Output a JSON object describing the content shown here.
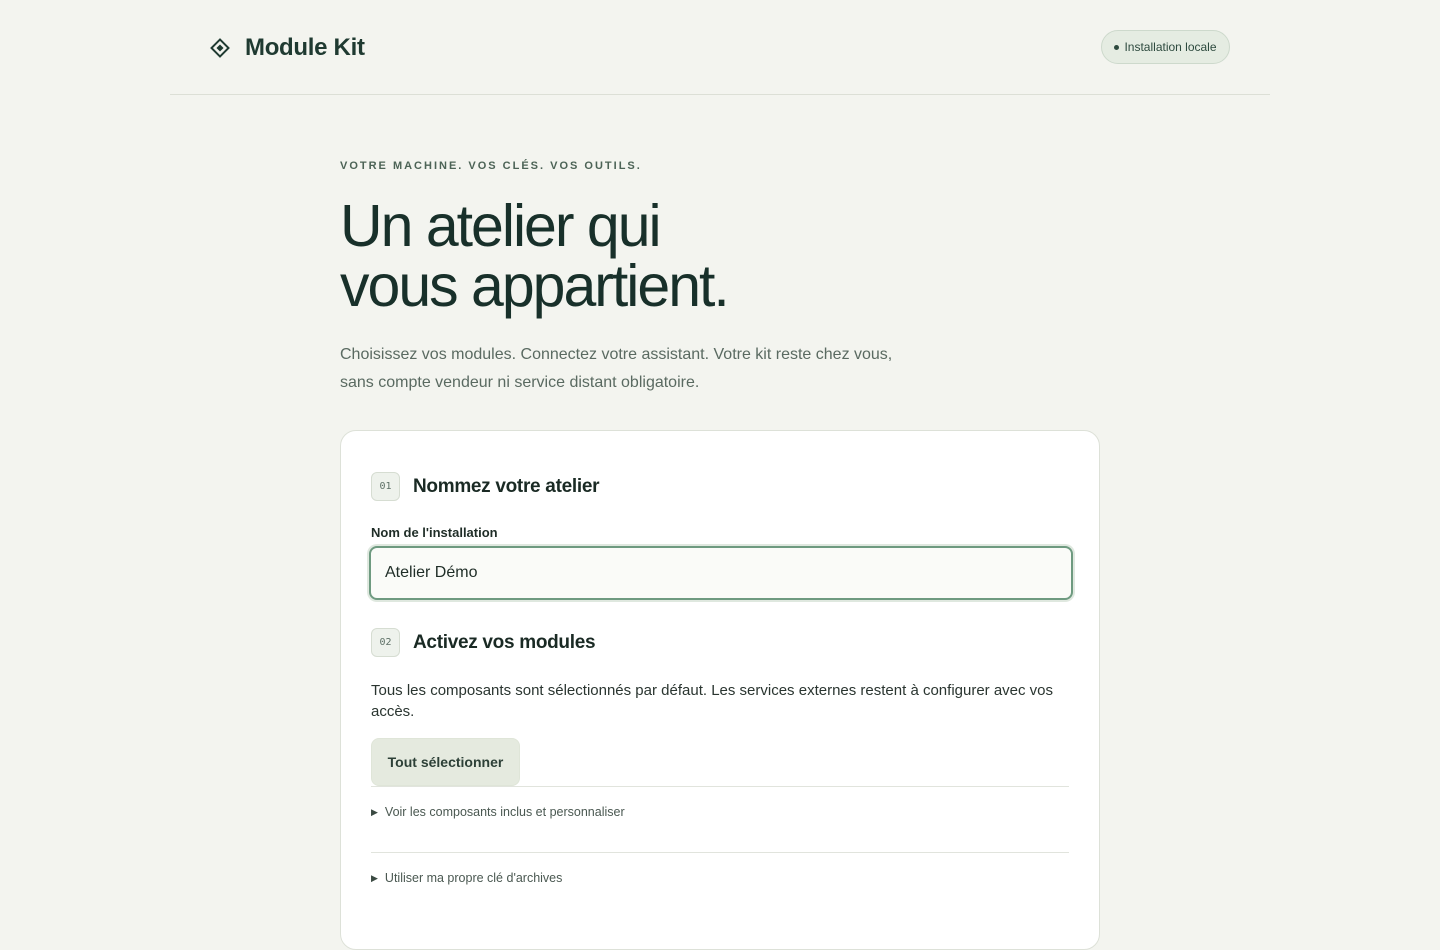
{
  "header": {
    "brand_name": "Module Kit",
    "brand_icon": "diamond-icon",
    "badge_text": "Installation locale"
  },
  "hero": {
    "eyebrow": "VOTRE MACHINE. VOS CLÉS. VOS OUTILS.",
    "title_line1": "Un atelier qui",
    "title_line2": "vous appartient.",
    "subtitle_line1": "Choisissez vos modules. Connectez votre assistant. Votre kit reste chez vous,",
    "subtitle_line2": "sans compte vendeur ni service distant obligatoire."
  },
  "step1": {
    "number": "01",
    "title": "Nommez votre atelier",
    "field_label": "Nom de l'installation",
    "field_value": "Atelier Démo"
  },
  "step2": {
    "number": "02",
    "title": "Activez vos modules",
    "description": "Tous les composants sont sélectionnés par défaut. Les services externes restent à configurer avec vos accès.",
    "select_all_label": "Tout sélectionner",
    "disclosure_components": "Voir les composants inclus et personnaliser",
    "disclosure_archive_key": "Utiliser ma propre clé d'archives"
  },
  "colors": {
    "background": "#f3f4ef",
    "accent": "#6e9a80",
    "brand": "#1f3a31"
  }
}
